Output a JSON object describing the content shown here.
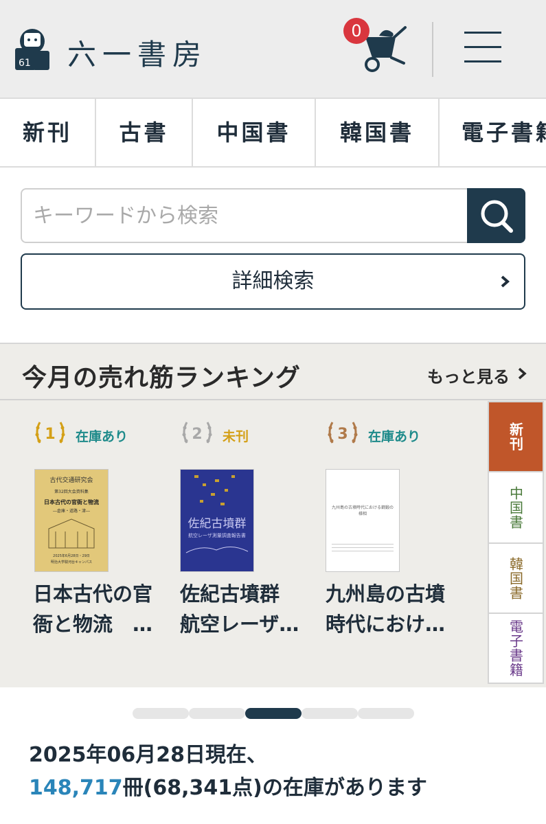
{
  "header": {
    "logo_text": "六一書房",
    "logo_badge": "61",
    "cart_count": "0"
  },
  "categories": [
    "新刊",
    "古書",
    "中国書",
    "韓国書",
    "電子書籍"
  ],
  "search": {
    "placeholder": "キーワードから検索",
    "advanced_label": "詳細検索"
  },
  "ranking": {
    "title": "今月の売れ筋ランキング",
    "more_label": "もっと見る",
    "items": [
      {
        "rank": "1",
        "stock": "在庫あり",
        "title_line1": "日本古代の官",
        "title_line2": "衙と物流　…",
        "cover_lines": [
          "古代交通研究会",
          "第32回大会資料集",
          "日本古代の官衙と物流",
          "―倉庫・道路・津―",
          "2025年6月28日・29日",
          "明治大学駿河台キャンパス"
        ]
      },
      {
        "rank": "2",
        "stock": "未刊",
        "title_line1": "佐紀古墳群",
        "title_line2": "航空レーザ…",
        "cover_lines": [
          "佐紀古墳群",
          "航空レーザ測量調査報告書"
        ]
      },
      {
        "rank": "3",
        "stock": "在庫あり",
        "title_line1": "九州島の古墳",
        "title_line2": "時代におけ…",
        "cover_lines": [
          "九州島の古墳時代における鋼鍛の様相"
        ]
      }
    ],
    "tabs": [
      "新刊",
      "中国書",
      "韓国書",
      "電子書籍"
    ]
  },
  "colors": {
    "navy": "#1f3a4c",
    "badge_red": "#d9363e",
    "in_stock": "#1d8a8a",
    "not_published": "#d4a017",
    "tab_new_bg": "#c0562a",
    "tab_china": "#4a7a3a",
    "tab_korea": "#8a6a2a",
    "tab_ebook": "#6a3a8a",
    "count_blue": "#2a85b9"
  },
  "pager": {
    "pages": 5,
    "active_index": 2
  },
  "stock_summary": {
    "line1": "2025年06月28日現在、",
    "count": "148,717",
    "line2_rest": "冊(68,341点)の在庫があります"
  }
}
